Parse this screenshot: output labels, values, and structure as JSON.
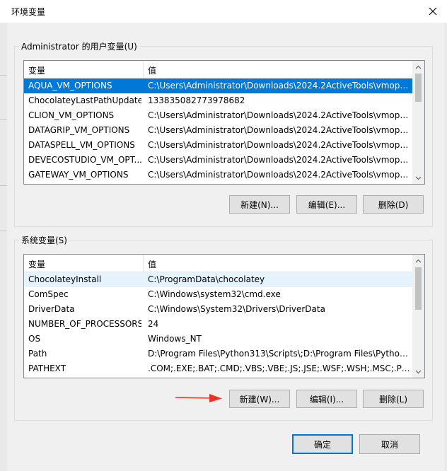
{
  "window": {
    "title": "环境变量"
  },
  "user_vars": {
    "legend": "Administrator 的用户变量(U)",
    "col_name": "变量",
    "col_value": "值",
    "rows": [
      {
        "name": "AQUA_VM_OPTIONS",
        "value": "C:\\Users\\Administrator\\Downloads\\2024.2ActiveTools\\vmopti..."
      },
      {
        "name": "ChocolateyLastPathUpdate",
        "value": "133835082773978682"
      },
      {
        "name": "CLION_VM_OPTIONS",
        "value": "C:\\Users\\Administrator\\Downloads\\2024.2ActiveTools\\vmopti..."
      },
      {
        "name": "DATAGRIP_VM_OPTIONS",
        "value": "C:\\Users\\Administrator\\Downloads\\2024.2ActiveTools\\vmopti..."
      },
      {
        "name": "DATASPELL_VM_OPTIONS",
        "value": "C:\\Users\\Administrator\\Downloads\\2024.2ActiveTools\\vmopti..."
      },
      {
        "name": "DEVECOSTUDIO_VM_OPT...",
        "value": "C:\\Users\\Administrator\\Downloads\\2024.2ActiveTools\\vmopti..."
      },
      {
        "name": "GATEWAY_VM_OPTIONS",
        "value": "C:\\Users\\Administrator\\Downloads\\2024.2ActiveTools\\vmopti..."
      }
    ],
    "btn_new": "新建(N)...",
    "btn_edit": "编辑(E)...",
    "btn_delete": "删除(D)"
  },
  "sys_vars": {
    "legend": "系统变量(S)",
    "col_name": "变量",
    "col_value": "值",
    "rows": [
      {
        "name": "ChocolateyInstall",
        "value": "C:\\ProgramData\\chocolatey"
      },
      {
        "name": "ComSpec",
        "value": "C:\\Windows\\system32\\cmd.exe"
      },
      {
        "name": "DriverData",
        "value": "C:\\Windows\\System32\\Drivers\\DriverData"
      },
      {
        "name": "NUMBER_OF_PROCESSORS",
        "value": "24"
      },
      {
        "name": "OS",
        "value": "Windows_NT"
      },
      {
        "name": "Path",
        "value": "D:\\Program Files\\Python313\\Scripts\\;D:\\Program Files\\Python..."
      },
      {
        "name": "PATHEXT",
        "value": ".COM;.EXE;.BAT;.CMD;.VBS;.VBE;.JS;.JSE;.WSF;.WSH;.MSC;.PY;.P..."
      }
    ],
    "btn_new": "新建(W)...",
    "btn_edit": "编辑(I)...",
    "btn_delete": "删除(L)"
  },
  "footer": {
    "ok": "确定",
    "cancel": "取消"
  },
  "colors": {
    "selection": "#0078d7",
    "arrow": "#e8322a"
  }
}
